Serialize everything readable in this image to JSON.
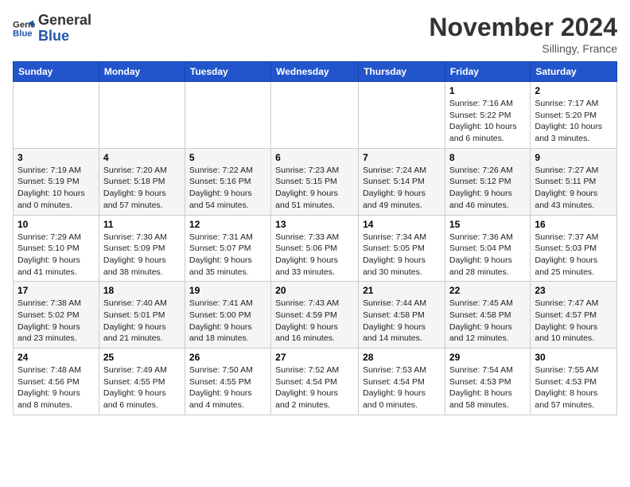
{
  "logo": {
    "line1": "General",
    "line2": "Blue"
  },
  "header": {
    "month": "November 2024",
    "location": "Sillingy, France"
  },
  "weekdays": [
    "Sunday",
    "Monday",
    "Tuesday",
    "Wednesday",
    "Thursday",
    "Friday",
    "Saturday"
  ],
  "weeks": [
    [
      {
        "day": "",
        "info": ""
      },
      {
        "day": "",
        "info": ""
      },
      {
        "day": "",
        "info": ""
      },
      {
        "day": "",
        "info": ""
      },
      {
        "day": "",
        "info": ""
      },
      {
        "day": "1",
        "info": "Sunrise: 7:16 AM\nSunset: 5:22 PM\nDaylight: 10 hours and 6 minutes."
      },
      {
        "day": "2",
        "info": "Sunrise: 7:17 AM\nSunset: 5:20 PM\nDaylight: 10 hours and 3 minutes."
      }
    ],
    [
      {
        "day": "3",
        "info": "Sunrise: 7:19 AM\nSunset: 5:19 PM\nDaylight: 10 hours and 0 minutes."
      },
      {
        "day": "4",
        "info": "Sunrise: 7:20 AM\nSunset: 5:18 PM\nDaylight: 9 hours and 57 minutes."
      },
      {
        "day": "5",
        "info": "Sunrise: 7:22 AM\nSunset: 5:16 PM\nDaylight: 9 hours and 54 minutes."
      },
      {
        "day": "6",
        "info": "Sunrise: 7:23 AM\nSunset: 5:15 PM\nDaylight: 9 hours and 51 minutes."
      },
      {
        "day": "7",
        "info": "Sunrise: 7:24 AM\nSunset: 5:14 PM\nDaylight: 9 hours and 49 minutes."
      },
      {
        "day": "8",
        "info": "Sunrise: 7:26 AM\nSunset: 5:12 PM\nDaylight: 9 hours and 46 minutes."
      },
      {
        "day": "9",
        "info": "Sunrise: 7:27 AM\nSunset: 5:11 PM\nDaylight: 9 hours and 43 minutes."
      }
    ],
    [
      {
        "day": "10",
        "info": "Sunrise: 7:29 AM\nSunset: 5:10 PM\nDaylight: 9 hours and 41 minutes."
      },
      {
        "day": "11",
        "info": "Sunrise: 7:30 AM\nSunset: 5:09 PM\nDaylight: 9 hours and 38 minutes."
      },
      {
        "day": "12",
        "info": "Sunrise: 7:31 AM\nSunset: 5:07 PM\nDaylight: 9 hours and 35 minutes."
      },
      {
        "day": "13",
        "info": "Sunrise: 7:33 AM\nSunset: 5:06 PM\nDaylight: 9 hours and 33 minutes."
      },
      {
        "day": "14",
        "info": "Sunrise: 7:34 AM\nSunset: 5:05 PM\nDaylight: 9 hours and 30 minutes."
      },
      {
        "day": "15",
        "info": "Sunrise: 7:36 AM\nSunset: 5:04 PM\nDaylight: 9 hours and 28 minutes."
      },
      {
        "day": "16",
        "info": "Sunrise: 7:37 AM\nSunset: 5:03 PM\nDaylight: 9 hours and 25 minutes."
      }
    ],
    [
      {
        "day": "17",
        "info": "Sunrise: 7:38 AM\nSunset: 5:02 PM\nDaylight: 9 hours and 23 minutes."
      },
      {
        "day": "18",
        "info": "Sunrise: 7:40 AM\nSunset: 5:01 PM\nDaylight: 9 hours and 21 minutes."
      },
      {
        "day": "19",
        "info": "Sunrise: 7:41 AM\nSunset: 5:00 PM\nDaylight: 9 hours and 18 minutes."
      },
      {
        "day": "20",
        "info": "Sunrise: 7:43 AM\nSunset: 4:59 PM\nDaylight: 9 hours and 16 minutes."
      },
      {
        "day": "21",
        "info": "Sunrise: 7:44 AM\nSunset: 4:58 PM\nDaylight: 9 hours and 14 minutes."
      },
      {
        "day": "22",
        "info": "Sunrise: 7:45 AM\nSunset: 4:58 PM\nDaylight: 9 hours and 12 minutes."
      },
      {
        "day": "23",
        "info": "Sunrise: 7:47 AM\nSunset: 4:57 PM\nDaylight: 9 hours and 10 minutes."
      }
    ],
    [
      {
        "day": "24",
        "info": "Sunrise: 7:48 AM\nSunset: 4:56 PM\nDaylight: 9 hours and 8 minutes."
      },
      {
        "day": "25",
        "info": "Sunrise: 7:49 AM\nSunset: 4:55 PM\nDaylight: 9 hours and 6 minutes."
      },
      {
        "day": "26",
        "info": "Sunrise: 7:50 AM\nSunset: 4:55 PM\nDaylight: 9 hours and 4 minutes."
      },
      {
        "day": "27",
        "info": "Sunrise: 7:52 AM\nSunset: 4:54 PM\nDaylight: 9 hours and 2 minutes."
      },
      {
        "day": "28",
        "info": "Sunrise: 7:53 AM\nSunset: 4:54 PM\nDaylight: 9 hours and 0 minutes."
      },
      {
        "day": "29",
        "info": "Sunrise: 7:54 AM\nSunset: 4:53 PM\nDaylight: 8 hours and 58 minutes."
      },
      {
        "day": "30",
        "info": "Sunrise: 7:55 AM\nSunset: 4:53 PM\nDaylight: 8 hours and 57 minutes."
      }
    ]
  ]
}
